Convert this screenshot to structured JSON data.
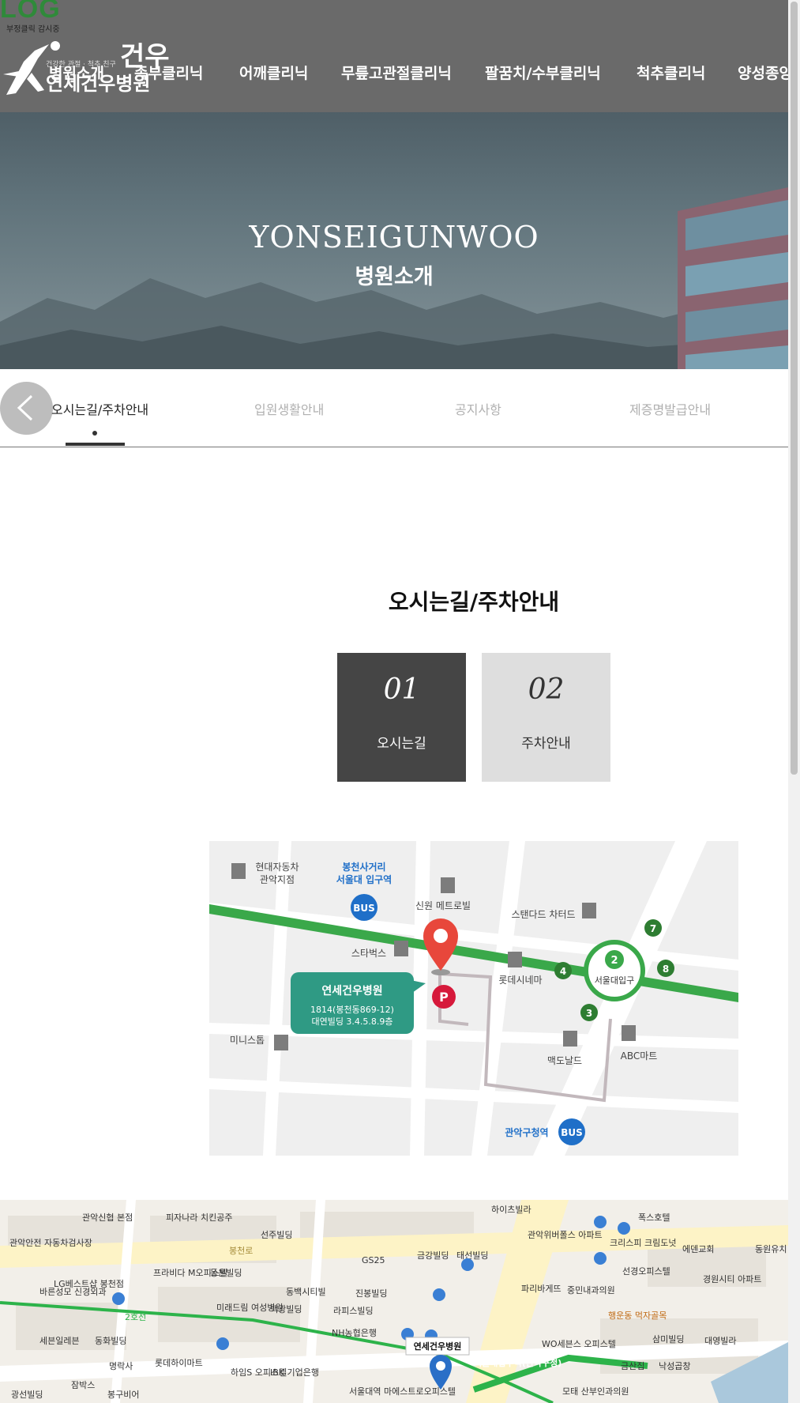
{
  "header": {
    "badge_brand": "LOG",
    "badge_sub": "부정클릭 감시중",
    "logo_tagline": "건강한 관절 · 척추 친구",
    "logo_mark": "건우",
    "logo_name": "연세건우병원",
    "nav": [
      "병원소개",
      "족부클리닉",
      "어깨클리닉",
      "무릎고관절클리닉",
      "팔꿈치/수부클리닉",
      "척추클리닉",
      "양성종양"
    ]
  },
  "hero": {
    "title": "YONSEIGUNWOO",
    "subtitle": "병원소개"
  },
  "subtabs": {
    "items": [
      "오시는길/주차안내",
      "입원생활안내",
      "공지사항",
      "제증명발급안내"
    ],
    "active": 0
  },
  "section": {
    "title": "오시는길/주차안내",
    "boxes": [
      {
        "num": "01",
        "label": "오시는길"
      },
      {
        "num": "02",
        "label": "주차안내"
      }
    ]
  },
  "illustrated_map": {
    "labels": {
      "hyundai": [
        "현대자동차",
        "관악지점"
      ],
      "bongcheon": [
        "봉천사거리",
        "서울대 입구역"
      ],
      "sinwon": "신원 메트로빌",
      "standard": "스탠다드 차터드",
      "starbucks": "스타벅스",
      "lotte": "롯데시네마",
      "station": "서울대입구",
      "ministop": "미니스톱",
      "mcdonalds": "맥도날드",
      "abc": "ABC마트",
      "gwanak": "관악구청역",
      "bus": "BUS",
      "parking": "P",
      "line_num": "2",
      "exits": [
        "7",
        "4",
        "8",
        "3"
      ]
    },
    "callout": {
      "name": "연세건우병원",
      "addr1": "1814(봉천동869-12)",
      "addr2": "대연빌딩 3.4.5.8.9층"
    },
    "colors": {
      "bg": "#efefef",
      "road": "#ffffff",
      "line2": "#3aa84a",
      "callout": "#2f9a84",
      "pin": "#e8473b",
      "bus": "#1f6fc8",
      "building": "#e2e2e2"
    }
  },
  "real_map": {
    "labels": [
      "관악신협 본점",
      "피자나라 치킨공주",
      "선주빌딩",
      "하이츠빌라",
      "관악위버폴스 아파트",
      "폭스호텔",
      "동원유치",
      "관악안전 자동차검사장",
      "프라비다 M오피스텔",
      "동은빌딩",
      "GS25",
      "금강빌딩",
      "태선빌딩",
      "크리스피 크림도넛",
      "에덴교회",
      "LG베스트샵 봉천점",
      "동백시티빌",
      "진봉빌딩",
      "파리바게뜨",
      "중민내과의원",
      "선경오피스텔",
      "경원시티 아파트",
      "바른성모 신경외과",
      "미래드림 여성병원",
      "백광빌딩",
      "라피스빌딩",
      "행운동 먹자골목",
      "삼미빌딩",
      "대영빌라",
      "세븐일레븐",
      "동화빌딩",
      "NH농협은행",
      "연세건우병원",
      "WO세븐스 오피스텔",
      "서울대입구역(관악구청)",
      "명락사",
      "롯데하이마트",
      "하임S 오피스텔",
      "IBK 기업은행",
      "금산집",
      "낙성곱창",
      "광선빌딩",
      "잠박스",
      "봉구비어",
      "서울대역 마에스트로오피스텔",
      "모태 산부인과의원",
      "봉천로",
      "2호선"
    ],
    "colors": {
      "bg": "#f2efe9",
      "road": "#fdf3c6",
      "line2": "#2db34a",
      "pin": "#2a6fc7"
    }
  },
  "colors": {
    "header_bg": "#6a6a6a",
    "active_box": "#454545",
    "inactive_box": "#dedede"
  }
}
